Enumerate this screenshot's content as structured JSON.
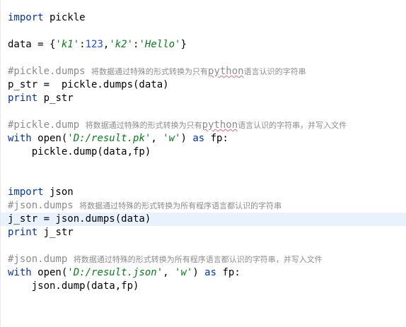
{
  "lines": {
    "l1": {
      "kw": "import",
      "rest": " pickle"
    },
    "l3": {
      "a": "data = {",
      "s1": "'k1'",
      "colon1": ":",
      "n1": "123",
      "comma": ",",
      "s2": "'k2'",
      "colon2": ":",
      "s3": "'Hello'",
      "close": "}"
    },
    "l5": {
      "c": "#pickle.dumps ",
      "t1": "将数据通过特殊的形式转换为只有",
      "typo": "python",
      "t2": "语言认识的字符串"
    },
    "l6": {
      "a": "p_str =  pickle.dumps(data)"
    },
    "l7": {
      "kw": "print",
      "rest": " p_str"
    },
    "l9": {
      "c": "#pickle.dump ",
      "t1": "将数据通过特殊的形式转换为只有",
      "typo": "python",
      "t2": "语言认识的字符串，并写入文件"
    },
    "l10": {
      "kw1": "with",
      "a": " open(",
      "s1": "'D:/result.pk'",
      "b": ", ",
      "s2": "'w'",
      "c": ") ",
      "kw2": "as",
      "d": " fp:"
    },
    "l11": {
      "a": "    pickle.dump(data,fp)"
    },
    "l14": {
      "kw": "import",
      "rest": " json"
    },
    "l15": {
      "c": "#json.dumps ",
      "t": "将数据通过特殊的形式转换为所有程序语言都认识的字符串"
    },
    "l16": {
      "a": "j_str = json.dumps(data)"
    },
    "l17": {
      "kw": "print",
      "rest": " j_str"
    },
    "l19": {
      "c": "#json.dump ",
      "t": "将数据通过特殊的形式转换为所有程序语言都认识的字符串，并写入文件"
    },
    "l20": {
      "kw1": "with",
      "a": " open(",
      "s1": "'D:/result.json'",
      "b": ", ",
      "s2": "'w'",
      "c": ") ",
      "kw2": "as",
      "d": " fp:"
    },
    "l21": {
      "a": "    json.dump(data,fp)"
    }
  },
  "colors": {
    "keyword": "#0033b3",
    "string": "#067d17",
    "number": "#1750eb",
    "comment": "#8c8c8c",
    "current_line": "#e8f2fe"
  }
}
